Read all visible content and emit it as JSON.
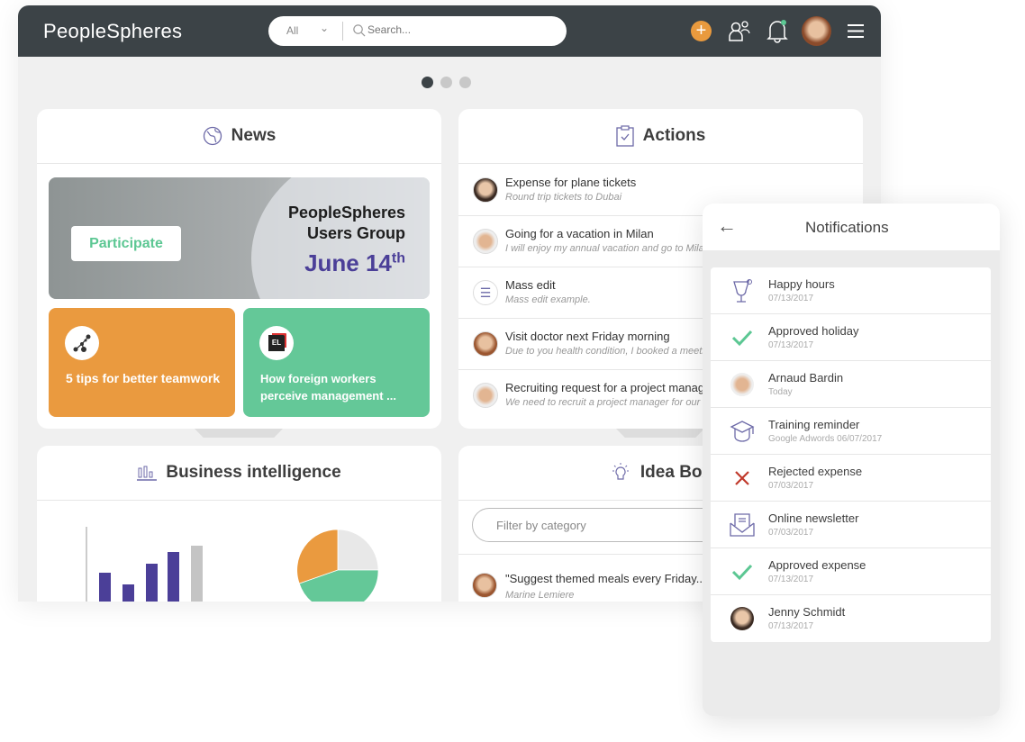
{
  "header": {
    "logo": "PeopleSpheres",
    "search_scope": "All",
    "search_placeholder": "Search...",
    "add_color": "#e99a3e"
  },
  "carousel": {
    "pages": 3,
    "active": 1
  },
  "news": {
    "title": "News",
    "banner": {
      "button": "Participate",
      "line1": "PeopleSpheres",
      "line2": "Users Group",
      "date": "June 14",
      "date_suffix": "th"
    },
    "tiles": [
      {
        "text": "5 tips for better teamwork",
        "color": "#ea9a3f"
      },
      {
        "text": "How foreign workers perceive management ...",
        "color": "#64c898"
      }
    ]
  },
  "actions": {
    "title": "Actions",
    "items": [
      {
        "title": "Expense for plane tickets",
        "sub": "Round trip tickets to Dubai"
      },
      {
        "title": "Going for a vacation in Milan",
        "sub": "I will enjoy my annual vacation and go to Milan"
      },
      {
        "title": "Mass edit",
        "sub": "Mass edit example."
      },
      {
        "title": "Visit doctor next Friday morning",
        "sub": "Due to you health condition, I booked a meeting"
      },
      {
        "title": "Recruiting request for a project manager",
        "sub": "We need to recruit a project manager for our team"
      }
    ]
  },
  "bi": {
    "title": "Business intelligence"
  },
  "idea": {
    "title": "Idea Box",
    "filter_placeholder": "Filter by category",
    "items": [
      {
        "quote": "\"Suggest themed meals every Friday..",
        "author": "Marine Lemiere"
      }
    ]
  },
  "notifications": {
    "title": "Notifications",
    "items": [
      {
        "title": "Happy hours",
        "date": "07/13/2017",
        "icon": "cocktail-icon"
      },
      {
        "title": "Approved holiday",
        "date": "07/13/2017",
        "icon": "check-icon"
      },
      {
        "title": "Arnaud Bardin",
        "date": "Today",
        "icon": "avatar"
      },
      {
        "title": "Training reminder",
        "date": "Google Adwords 06/07/2017",
        "icon": "graduation-cap-icon"
      },
      {
        "title": "Rejected expense",
        "date": "07/03/2017",
        "icon": "cross-icon"
      },
      {
        "title": "Online newsletter",
        "date": "07/03/2017",
        "icon": "envelope-icon"
      },
      {
        "title": "Approved expense",
        "date": "07/13/2017",
        "icon": "check-icon"
      },
      {
        "title": "Jenny Schmidt",
        "date": "07/13/2017",
        "icon": "avatar"
      }
    ]
  }
}
